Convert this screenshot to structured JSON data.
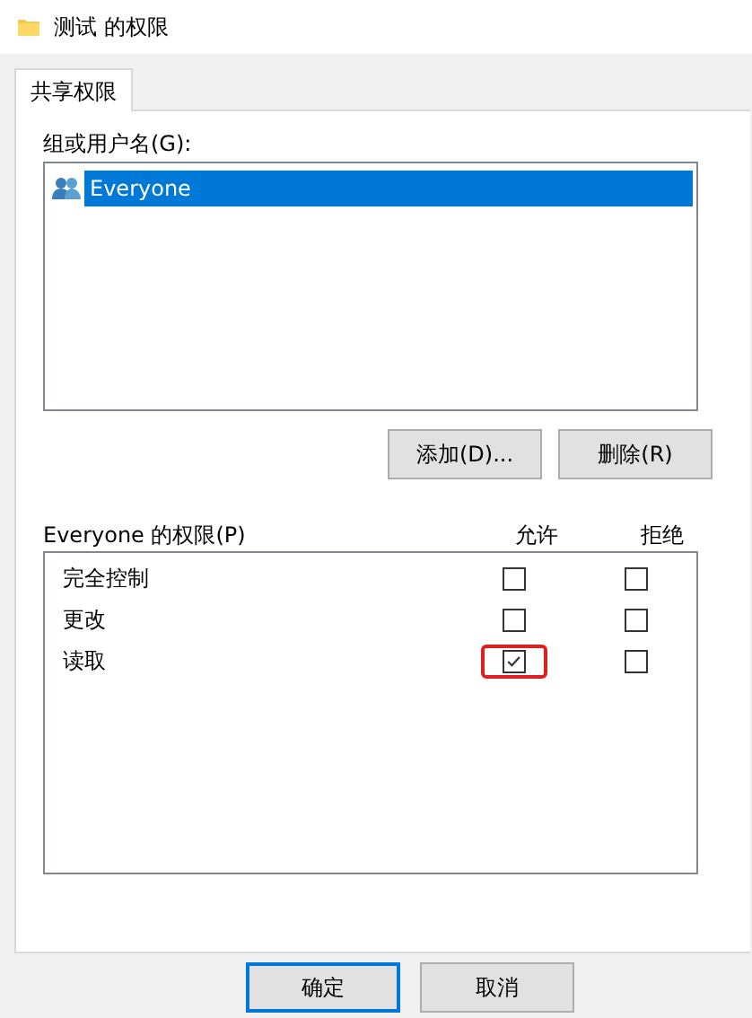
{
  "window": {
    "title": "测试 的权限"
  },
  "tabs": [
    {
      "label": "共享权限",
      "selected": true
    }
  ],
  "users": {
    "label": "组或用户名(G):",
    "items": [
      {
        "name": "Everyone",
        "selected": true
      }
    ]
  },
  "user_buttons": [
    "添加(D)...",
    "删除(R)"
  ],
  "permissions": {
    "label": "Everyone 的权限(P)",
    "columns": [
      "允许",
      "拒绝"
    ],
    "rows": [
      {
        "name": "完全控制",
        "allow": false,
        "deny": false,
        "highlighted": false
      },
      {
        "name": "更改",
        "allow": false,
        "deny": false,
        "highlighted": false
      },
      {
        "name": "读取",
        "allow": true,
        "deny": false,
        "highlighted": true
      }
    ]
  },
  "buttons": [
    {
      "label": "确定",
      "default": true
    },
    {
      "label": "取消",
      "default": false
    }
  ]
}
